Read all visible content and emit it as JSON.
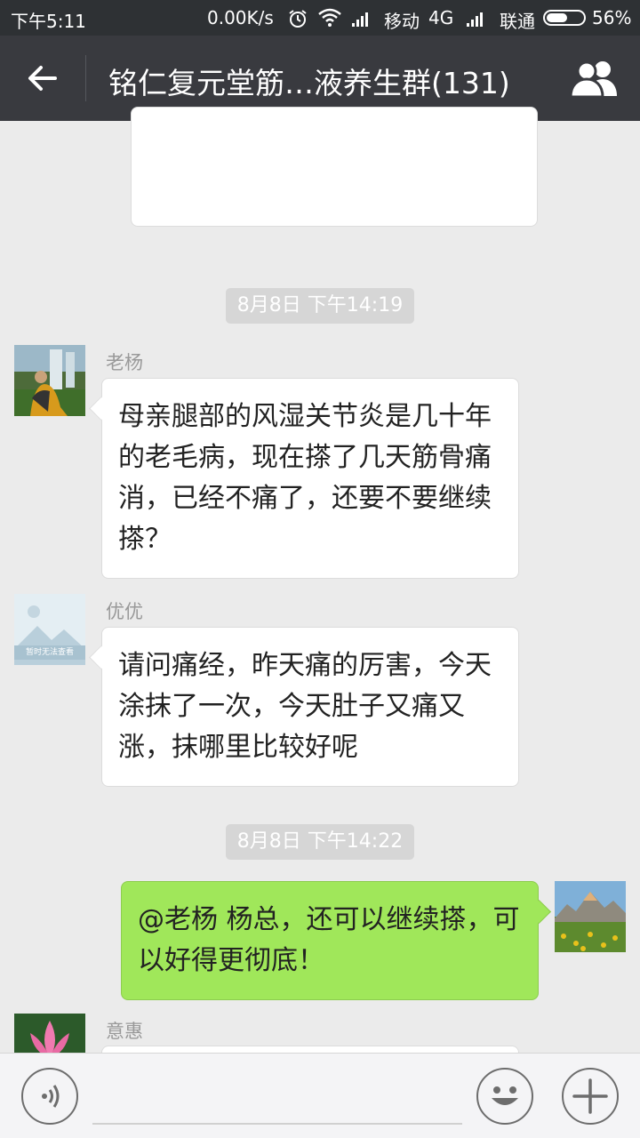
{
  "status_bar": {
    "time": "下午5:11",
    "speed": "0.00K/s",
    "carrier1": "移动",
    "network": "4G",
    "carrier2": "联通",
    "battery": "56%",
    "battery_level": 0.56
  },
  "header": {
    "title": "铭仁复元堂筋…液养生群(131)",
    "back_icon": "arrow-left-icon",
    "members_icon": "group-icon"
  },
  "messages": [
    {
      "type": "time",
      "text": "8月8日 下午14:19"
    },
    {
      "type": "incoming",
      "sender": "老杨",
      "text": "母亲腿部的风湿关节炎是几十年的老毛病，现在搽了几天筋骨痛消，已经不痛了，还要不要继续搽？"
    },
    {
      "type": "incoming",
      "sender": "优优",
      "avatar_caption": "暂时无法查看",
      "text": "请问痛经，昨天痛的厉害，今天涂抹了一次，今天肚子又痛又涨，抹哪里比较好呢"
    },
    {
      "type": "time",
      "text": "8月8日 下午14:22"
    },
    {
      "type": "outgoing",
      "text": "@老杨 杨总，还可以继续搽，可以好得更彻底！"
    },
    {
      "type": "incoming",
      "sender": "意惠",
      "text": ""
    }
  ],
  "input_bar": {
    "voice_icon": "voice-icon",
    "emoji_icon": "emoji-icon",
    "plus_icon": "plus-icon"
  },
  "colors": {
    "status_bg": "#2e3134",
    "header_bg": "#393a3f",
    "chat_bg": "#ebebeb",
    "outgoing_bubble": "#a0e75a",
    "incoming_bubble": "#ffffff"
  }
}
